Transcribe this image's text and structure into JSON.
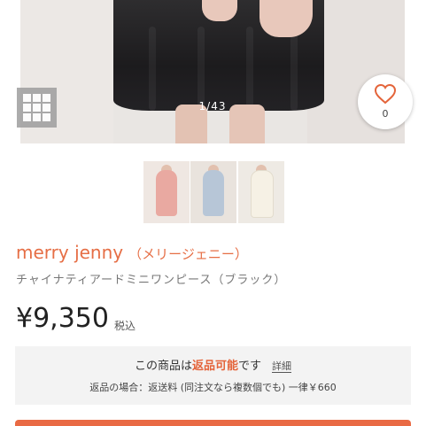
{
  "gallery": {
    "counter": "1/43",
    "favorite_count": "0"
  },
  "product": {
    "brand": "merry jenny",
    "brand_kana": "（メリージェニー）",
    "name": "チャイナティアードミニワンピース（ブラック）",
    "price": "¥9,350",
    "tax_label": "税込"
  },
  "returns": {
    "prefix": "この商品は",
    "accent": "返品可能",
    "suffix": "です",
    "detail_link": "詳細",
    "fee_text": "返品の場合：返送料 (同注文なら複数個でも) 一律￥660"
  },
  "colors": {
    "brand_accent": "#e66e45",
    "return_accent": "#e4643a",
    "cta": "#e96a44"
  },
  "icons": [
    "grid-icon",
    "heart-icon"
  ]
}
